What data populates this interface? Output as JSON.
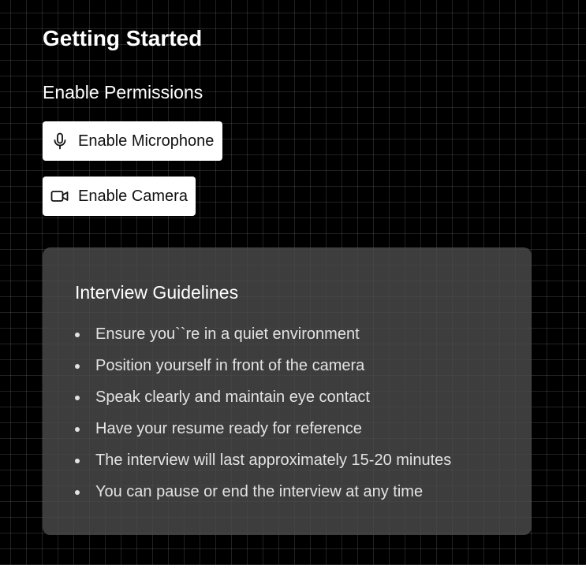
{
  "page": {
    "title": "Getting Started"
  },
  "permissions": {
    "heading": "Enable Permissions",
    "microphone": {
      "label": "Enable Microphone",
      "icon": "microphone-icon"
    },
    "camera": {
      "label": "Enable Camera",
      "icon": "video-camera-icon"
    }
  },
  "guidelines": {
    "title": "Interview Guidelines",
    "items": [
      "Ensure you``re in a quiet environment",
      "Position yourself in front of the camera",
      "Speak clearly and maintain eye contact",
      "Have your resume ready for reference",
      "The interview will last approximately 15-20 minutes",
      "You can pause or end the interview at any time"
    ]
  },
  "colors": {
    "background": "#000000",
    "button_background": "#ffffff",
    "panel_background": "#4b4b4b",
    "text": "#ffffff"
  }
}
